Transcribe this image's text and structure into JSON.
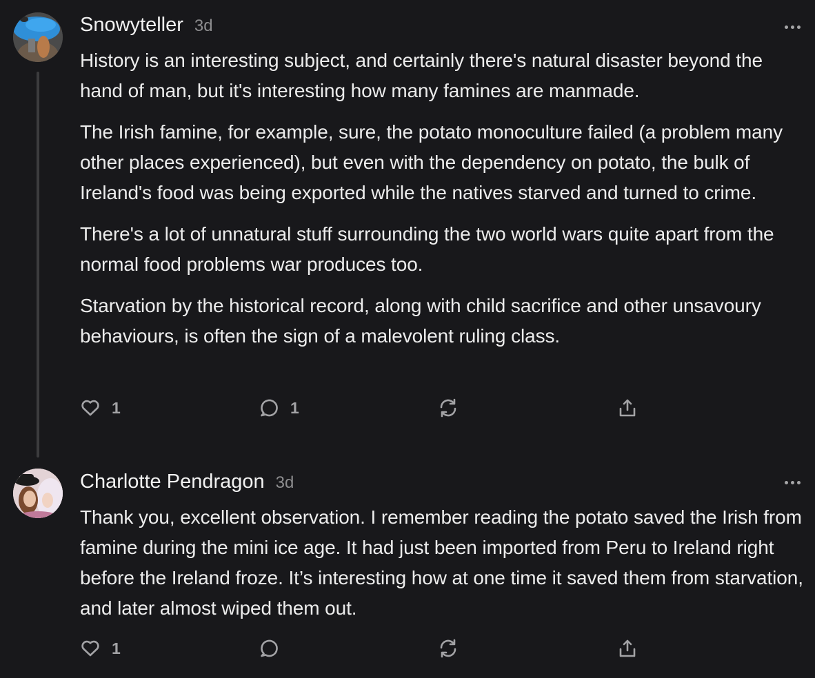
{
  "comments": [
    {
      "author": "Snowyteller",
      "time": "3d",
      "paragraphs": [
        "History is an interesting subject, and certainly there's natural disaster beyond the hand of man, but it's interesting how many famines are manmade.",
        "The Irish famine, for example, sure, the potato monoculture failed (a problem many other places experienced), but even with the dependency on potato, the bulk of Ireland's food was being exported while the natives starved and turned to crime.",
        "There's a lot of unnatural stuff surrounding the two world wars quite apart from the normal food problems war produces too.",
        "Starvation by the historical record, along with child sacrifice and other unsavoury behaviours, is often the sign of a malevolent ruling class."
      ],
      "likes": "1",
      "replies": "1"
    },
    {
      "author": "Charlotte Pendragon",
      "time": "3d",
      "paragraphs": [
        "Thank you, excellent observation. I remember reading the potato saved the Irish from famine during the mini ice age. It had just been imported from Peru to Ireland right before the Ireland froze. It’s interesting how at one time it saved them from starvation, and later almost wiped them out."
      ],
      "likes": "1",
      "replies": ""
    }
  ],
  "icons": {
    "like": "heart-icon",
    "reply": "speech-bubble-icon",
    "restack": "restack-icon",
    "share": "share-icon",
    "more": "more-dots-icon"
  },
  "colors": {
    "background": "#18181b",
    "text": "#ececec",
    "muted": "#8d8d8f",
    "icon": "#a3a3a6"
  }
}
